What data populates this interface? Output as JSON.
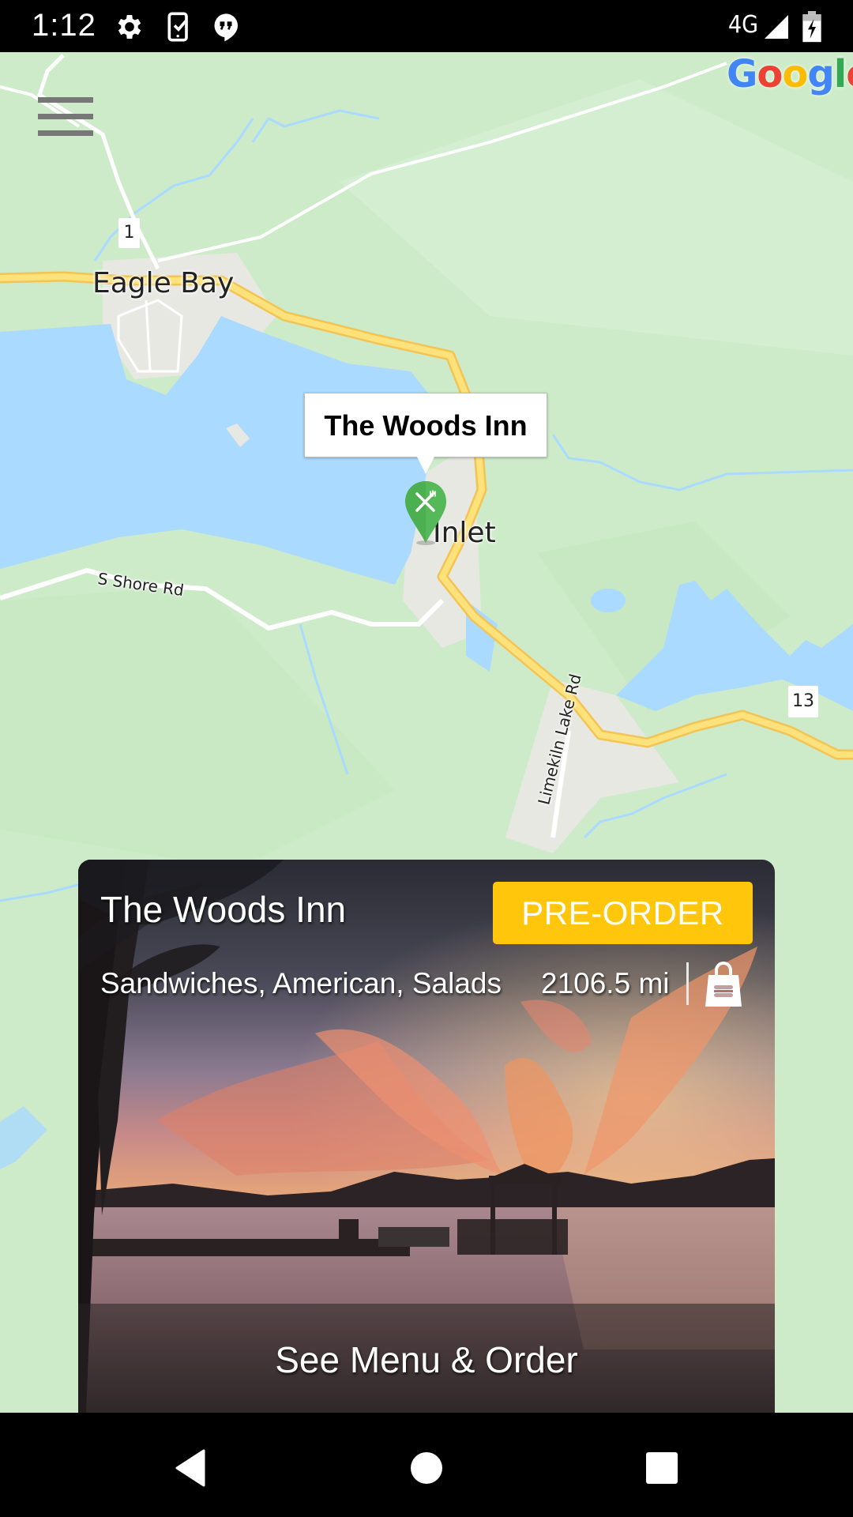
{
  "status_bar": {
    "time": "1:12",
    "notification_icons": [
      "settings-icon",
      "device-check-icon",
      "hangouts-icon"
    ],
    "network": "4G",
    "signal_icon": "cell-signal-icon",
    "battery_icon": "battery-charging-icon"
  },
  "map": {
    "provider_logo": "Google",
    "logo_colors": [
      "#4285F4",
      "#EA4335",
      "#FBBC05",
      "#4285F4",
      "#34A853",
      "#EA4335"
    ],
    "labels": {
      "eagle_bay": "Eagle Bay",
      "inlet": "Inlet",
      "s_shore_rd": "S Shore Rd",
      "limekiln_lake_rd": "Limekiln Lake Rd"
    },
    "route_shields": {
      "route_1": "1",
      "route_13": "13"
    },
    "marker": {
      "icon": "restaurant-icon",
      "color": "#4caf50",
      "callout_title": "The Woods Inn"
    },
    "colors": {
      "land": "#cdebc9",
      "water": "#aadaff",
      "highway": "#fdd86a",
      "urban": "#e8e8e3"
    }
  },
  "menu_button": {
    "icon": "hamburger-menu-icon"
  },
  "restaurant_card": {
    "name": "The Woods Inn",
    "cuisine": "Sandwiches, American, Salads",
    "distance": "2106.5 mi",
    "order_type_icon": "takeout-bag-icon",
    "preorder_label": "PRE-ORDER",
    "preorder_color": "#ffc60b",
    "menu_link_label": "See Menu & Order"
  },
  "nav_bar": {
    "back": "back-icon",
    "home": "home-icon",
    "recents": "recents-icon"
  }
}
